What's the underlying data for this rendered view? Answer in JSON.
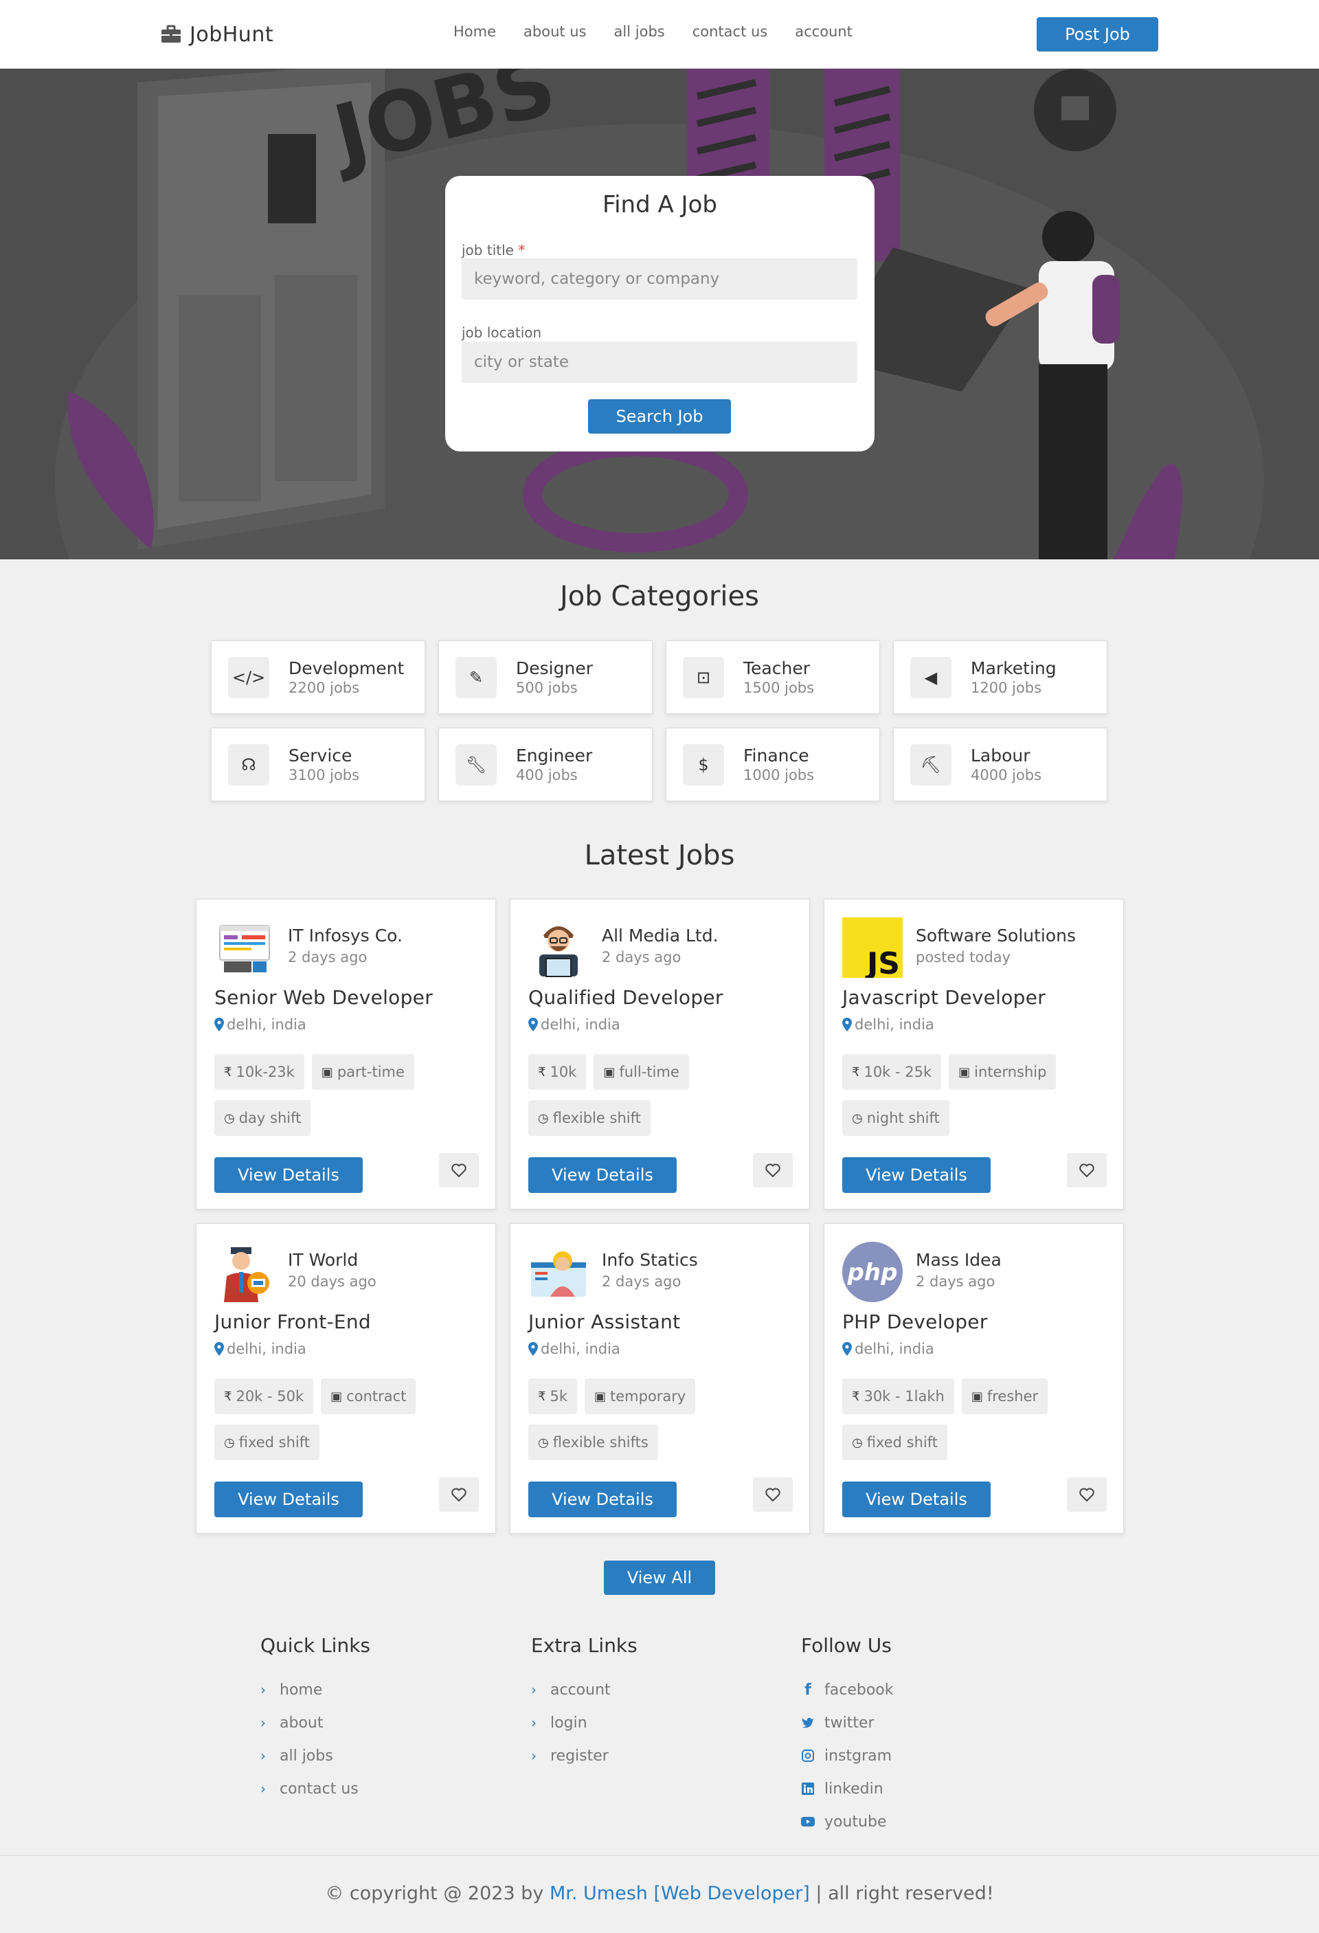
{
  "header": {
    "brand": "JobHunt",
    "nav": [
      "Home",
      "about us",
      "all jobs",
      "contact us",
      "account"
    ],
    "post_job_label": "Post Job"
  },
  "hero": {
    "search_title": "Find A Job",
    "job_title_label": "job title",
    "required_mark": "*",
    "job_title_placeholder": "keyword, category or company",
    "job_location_label": "job location",
    "job_location_placeholder": "city or state",
    "search_button": "Search Job"
  },
  "categories": {
    "title": "Job Categories",
    "items": [
      {
        "name": "Development",
        "count": "2200 jobs",
        "icon": "code-icon"
      },
      {
        "name": "Designer",
        "count": "500 jobs",
        "icon": "pencil-icon"
      },
      {
        "name": "Teacher",
        "count": "1500 jobs",
        "icon": "teacher-icon"
      },
      {
        "name": "Marketing",
        "count": "1200 jobs",
        "icon": "megaphone-icon"
      },
      {
        "name": "Service",
        "count": "3100 jobs",
        "icon": "headset-icon"
      },
      {
        "name": "Engineer",
        "count": "400 jobs",
        "icon": "wrench-icon"
      },
      {
        "name": "Finance",
        "count": "1000 jobs",
        "icon": "hand-dollar-icon"
      },
      {
        "name": "Labour",
        "count": "4000 jobs",
        "icon": "worker-icon"
      }
    ]
  },
  "jobs": {
    "title": "Latest Jobs",
    "items": [
      {
        "company": "IT Infosys Co.",
        "posted": "2 days ago",
        "title": "Senior Web Developer",
        "location": "delhi, india",
        "salary": "10k-23k",
        "type": "part-time",
        "shift": "day shift",
        "logo": "web-dev-illustration"
      },
      {
        "company": "All Media Ltd.",
        "posted": "2 days ago",
        "title": "Qualified Developer",
        "location": "delhi, india",
        "salary": "10k",
        "type": "full-time",
        "shift": "flexible shift",
        "logo": "developer-avatar"
      },
      {
        "company": "Software Solutions",
        "posted": "posted today",
        "title": "Javascript Developer",
        "location": "delhi, india",
        "salary": "10k - 25k",
        "type": "internship",
        "shift": "night shift",
        "logo": "js-logo"
      },
      {
        "company": "IT World",
        "posted": "20 days ago",
        "title": "Junior Front-End",
        "location": "delhi, india",
        "salary": "20k - 50k",
        "type": "contract",
        "shift": "fixed shift",
        "logo": "frontend-avatar"
      },
      {
        "company": "Info Statics",
        "posted": "2 days ago",
        "title": "Junior Assistant",
        "location": "delhi, india",
        "salary": "5k",
        "type": "temporary",
        "shift": "flexible shifts",
        "logo": "assistant-avatar"
      },
      {
        "company": "Mass Idea",
        "posted": "2 days ago",
        "title": "PHP Developer",
        "location": "delhi, india",
        "salary": "30k - 1lakh",
        "type": "fresher",
        "shift": "fixed shift",
        "logo": "php-logo"
      }
    ],
    "view_details_label": "View Details",
    "view_all_label": "View All"
  },
  "footer": {
    "quick_links": {
      "title": "Quick Links",
      "items": [
        "home",
        "about",
        "all jobs",
        "contact us"
      ]
    },
    "extra_links": {
      "title": "Extra Links",
      "items": [
        "account",
        "login",
        "register"
      ]
    },
    "follow_us": {
      "title": "Follow Us",
      "items": [
        {
          "label": "facebook",
          "icon": "facebook-icon"
        },
        {
          "label": "twitter",
          "icon": "twitter-icon"
        },
        {
          "label": "instgram",
          "icon": "instagram-icon"
        },
        {
          "label": "linkedin",
          "icon": "linkedin-icon"
        },
        {
          "label": "youtube",
          "icon": "youtube-icon"
        }
      ]
    },
    "copyright_prefix": "© copyright @ 2023 by ",
    "copyright_author": "Mr. Umesh [Web Developer]",
    "copyright_suffix": " | all right reserved!"
  },
  "colors": {
    "accent": "#2a7dc0",
    "hero_bg": "#4e4e4e",
    "page_bg": "#f0f0f1"
  }
}
